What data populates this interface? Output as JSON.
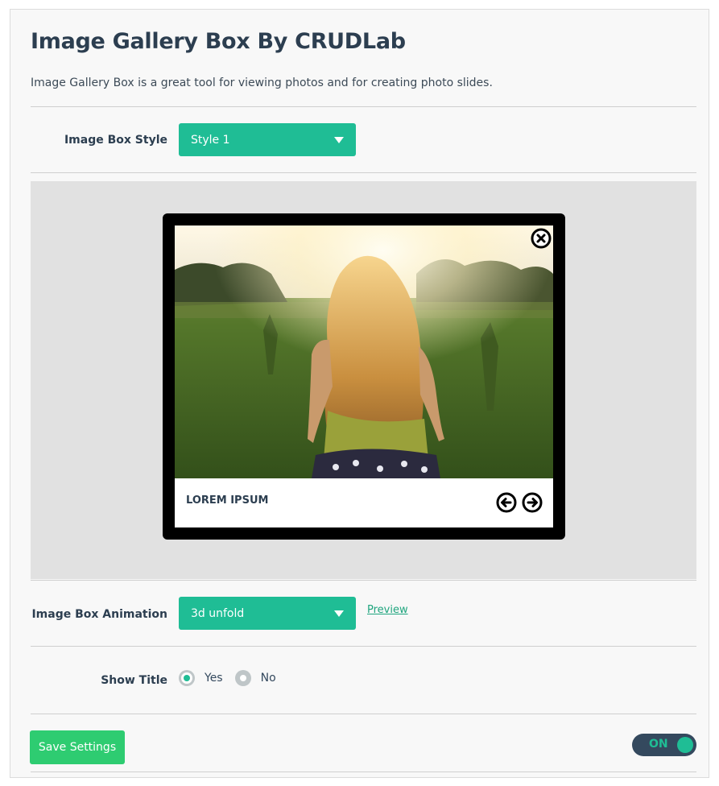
{
  "page": {
    "title": "Image Gallery Box By CRUDLab",
    "description": "Image Gallery Box is a great tool for viewing photos and for creating photo slides."
  },
  "style_field": {
    "label": "Image Box Style",
    "value": "Style 1"
  },
  "preview": {
    "caption": "LOREM IPSUM",
    "close_icon": "close-circle-icon",
    "prev_icon": "arrow-left-circle-icon",
    "next_icon": "arrow-right-circle-icon"
  },
  "animation_field": {
    "label": "Image Box Animation",
    "value": "3d unfold",
    "preview_link": "Preview"
  },
  "show_title_field": {
    "label": "Show Title",
    "options": [
      {
        "label": "Yes",
        "checked": true
      },
      {
        "label": "No",
        "checked": false
      }
    ]
  },
  "footer": {
    "save_label": "Save Settings",
    "toggle_label": "ON",
    "toggle_on": true
  },
  "colors": {
    "accent": "#1fbd95",
    "save_button": "#2ecc71",
    "toggle_bg": "#34495e",
    "text_dark": "#2c3e50"
  }
}
